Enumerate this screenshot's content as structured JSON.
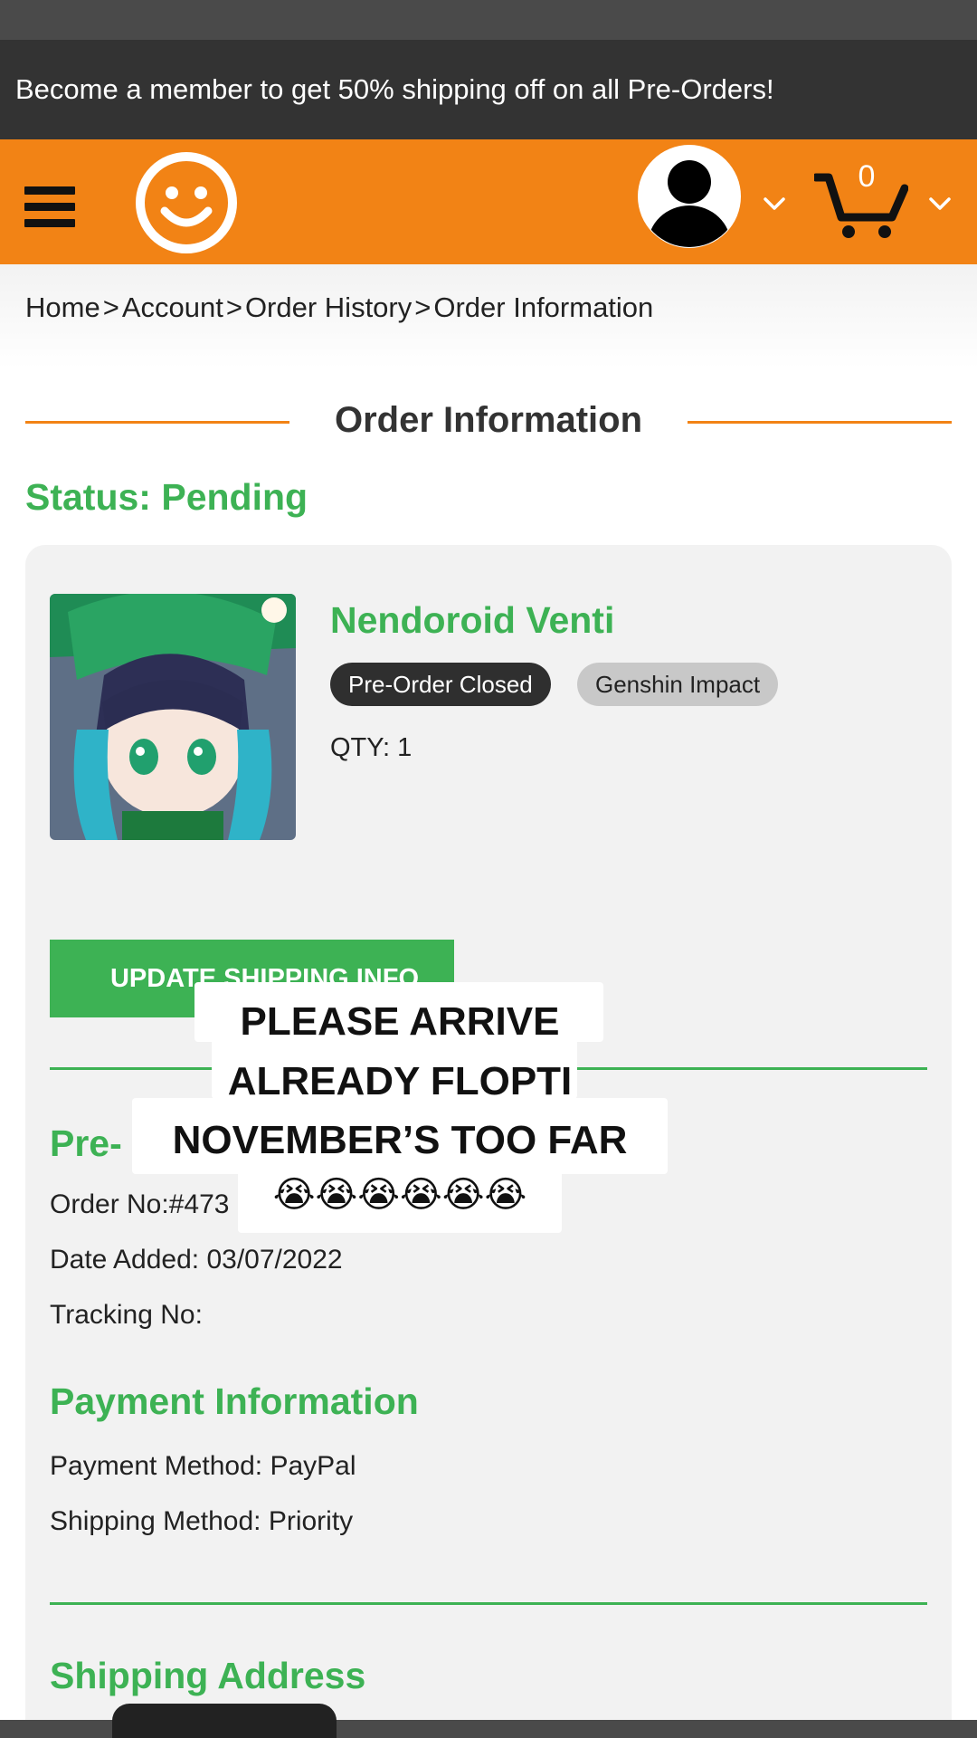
{
  "promo_banner": "Become a member to get 50% shipping off on all Pre-Orders!",
  "header": {
    "menu_icon": "hamburger-menu-icon",
    "logo_icon": "smiley-face-logo",
    "account_icon": "user-avatar-icon",
    "cart_icon": "shopping-cart-icon",
    "cart_count": "0",
    "accent_color": "#f28315"
  },
  "breadcrumb": [
    "Home",
    "Account",
    "Order History",
    "Order Information"
  ],
  "breadcrumb_sep": ">",
  "page_title": "Order Information",
  "status": "Status: Pending",
  "product": {
    "name": "Nendoroid Venti",
    "tags": [
      "Pre-Order Closed",
      "Genshin Impact"
    ],
    "qty": "QTY: 1"
  },
  "update_button": "UPDATE SHIPPING INFO",
  "preorder_section": {
    "heading": "Pre-",
    "order_no": "Order No:#473",
    "date_added": "Date Added: 03/07/2022",
    "tracking_no": "Tracking No:"
  },
  "payment_section": {
    "heading": "Payment Information",
    "payment_method": "Payment Method: PayPal",
    "shipping_method": "Shipping Method: Priority"
  },
  "shipping_section": {
    "heading": "Shipping Address"
  },
  "overlay": {
    "lines": [
      "PLEASE ARRIVE",
      "ALREADY FLOPTI",
      "NOVEMBER’S TOO FAR",
      "😭😭😭😭😭😭"
    ]
  },
  "colors": {
    "green": "#3db254",
    "orange": "#f28315",
    "dark": "#333333"
  }
}
